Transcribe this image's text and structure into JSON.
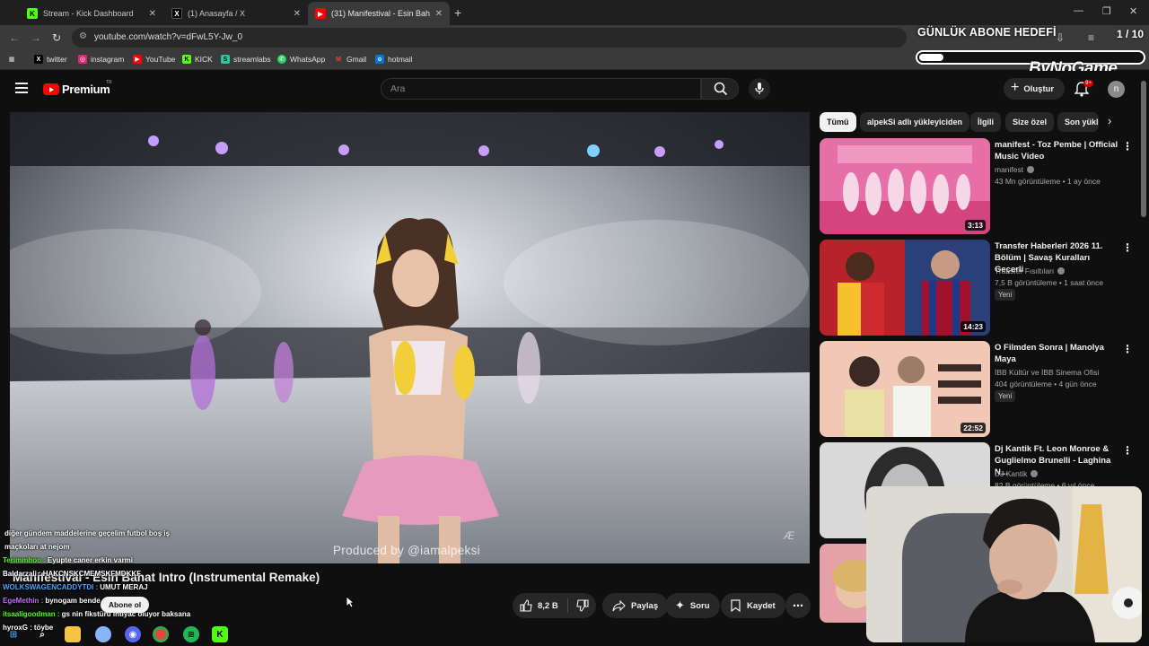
{
  "browser": {
    "tabs": [
      {
        "title": "Stream - Kick Dashboard",
        "favicon": "kick-icon",
        "color": "#53fc18",
        "active": false
      },
      {
        "title": "(1) Anasayfa / X",
        "favicon": "x-icon",
        "color": "#000000",
        "active": false
      },
      {
        "title": "(31) Manifestival - Esin Bahat In",
        "favicon": "youtube-icon",
        "color": "#ff0000",
        "active": true
      }
    ],
    "url": "youtube.com/watch?v=dFwL5Y-Jw_0",
    "bookmarks": [
      {
        "label": "twitter",
        "icon": "x-icon",
        "color": "#000000"
      },
      {
        "label": "instagram",
        "icon": "instagram-icon",
        "color": "#d62976"
      },
      {
        "label": "YouTube",
        "icon": "youtube-icon",
        "color": "#ff0000"
      },
      {
        "label": "KICK",
        "icon": "kick-icon",
        "color": "#53fc18"
      },
      {
        "label": "streamlabs",
        "icon": "streamlabs-icon",
        "color": "#31c3a2"
      },
      {
        "label": "WhatsApp",
        "icon": "whatsapp-icon",
        "color": "#25d366"
      },
      {
        "label": "Gmail",
        "icon": "gmail-icon",
        "color": "#ea4335"
      },
      {
        "label": "hotmail",
        "icon": "outlook-icon",
        "color": "#0078d4"
      }
    ]
  },
  "overlay": {
    "goal_label": "GÜNLÜK ABONE HEDEFİ",
    "goal_count": "1 / 10",
    "goal_progress": 0.1,
    "brand": "ByNoGame"
  },
  "youtube": {
    "logo_word": "Premium",
    "logo_tr": "TR",
    "search_placeholder": "Ara",
    "create_label": "Oluştur",
    "notifications_badge": "9+",
    "avatar_letter": "n",
    "chips": [
      "Tümü",
      "alpekSi adlı yükleyiciden",
      "İlgili",
      "Size özel",
      "Son yükl"
    ],
    "video": {
      "title": "Manifestival - Esin Bahat Intro (Instrumental Remake)",
      "watermark": "Produced by @iamalpeksi",
      "likes": "8,2 B",
      "share": "Paylaş",
      "ask": "Soru",
      "save": "Kaydet",
      "subscribe": "Abone ol"
    },
    "recommendations": [
      {
        "title": "manifest - Toz Pembe | Official Music Video",
        "channel": "manifest",
        "verified": true,
        "meta": "43 Mn görüntüleme • 1 ay önce",
        "duration": "3:13",
        "badge": ""
      },
      {
        "title": "Transfer Haberleri 2026 11. Bölüm | Savaş Kuralları Geçerli",
        "channel": "Transfer Fısıltıları",
        "verified": true,
        "meta": "7,5 B görüntüleme • 1 saat önce",
        "duration": "14:23",
        "badge": "Yeni"
      },
      {
        "title": "O Filmden Sonra | Manolya Maya",
        "channel": "İBB Kültür ve İBB Sinema Ofisi",
        "verified": false,
        "meta": "404 görüntüleme • 4 gün önce",
        "duration": "22:52",
        "badge": "Yeni"
      },
      {
        "title": "Dj Kantik Ft. Leon Monroe & Guglielmo Brunelli - Laghina N...",
        "channel": "DJ Kantik",
        "verified": true,
        "meta": "82 B görüntüleme • 6 yıl önce",
        "duration": "",
        "badge": ""
      }
    ]
  },
  "chat": [
    {
      "user": "",
      "user_color": "#4a90e2",
      "text": "diğer gündem maddelerine geçelim futbol boş iş"
    },
    {
      "user": "",
      "user_color": "#e05fb4",
      "text": "maçkoları at nejom"
    },
    {
      "user": "Terimmhoo",
      "user_color": "#53fc18",
      "text": "Eyupte caner erkin varmi"
    },
    {
      "user": "Baldarzali",
      "user_color": "#ffffff",
      "text": "HAKCNSKCMEMSKFMDKKF"
    },
    {
      "user": "WOLKSWAGENCADDYTDI",
      "user_color": "#4aa3ff",
      "text": "UMUT MERAJ"
    },
    {
      "user": "EgeMethin",
      "user_color": "#c06cff",
      "text": "bynogam bende ammı"
    },
    {
      "user": "itsaaligoodman",
      "user_color": "#53fc18",
      "text": "gs nin fikstürü ihtiyac oluyor baksana"
    },
    {
      "user": "hyroxG",
      "user_color": "#ffffff",
      "text": "töybe"
    }
  ],
  "taskbar": [
    {
      "icon": "windows-icon",
      "color": "#4aa3ff"
    },
    {
      "icon": "search-icon",
      "color": "#ffffff"
    },
    {
      "icon": "file-explorer-icon",
      "color": "#f4c542"
    },
    {
      "icon": "app-icon",
      "color": "#8ab4f8"
    },
    {
      "icon": "discord-icon",
      "color": "#5865f2"
    },
    {
      "icon": "chrome-icon",
      "color": "#e8453c"
    },
    {
      "icon": "spotify-icon",
      "color": "#1db954"
    },
    {
      "icon": "kick-icon",
      "color": "#53fc18"
    }
  ]
}
